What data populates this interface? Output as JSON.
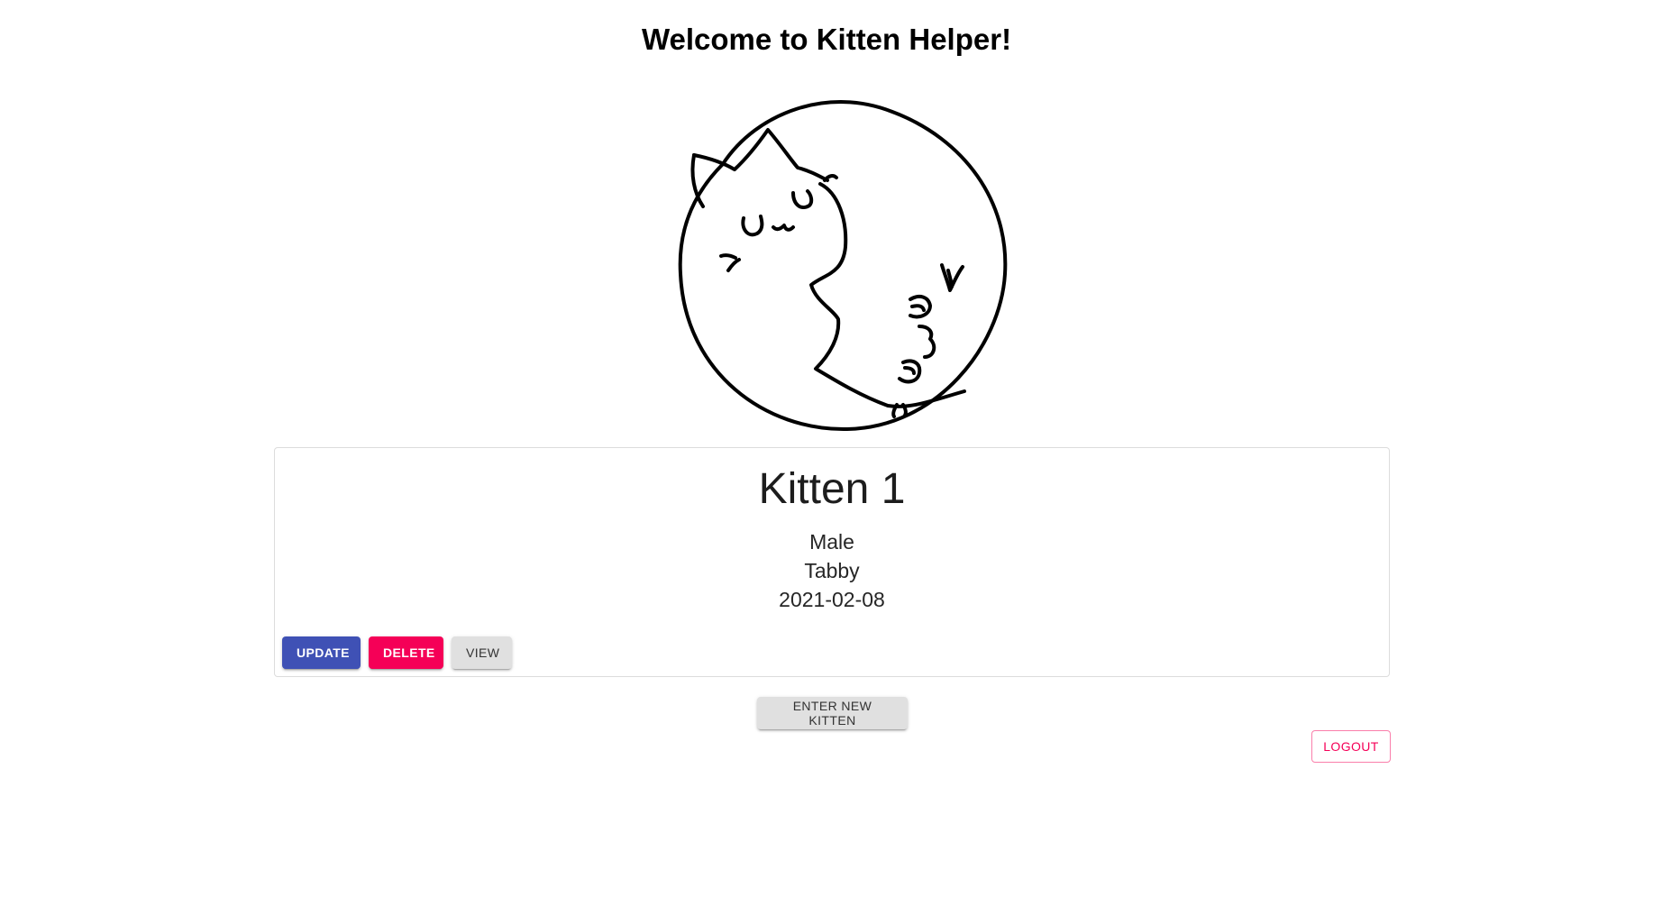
{
  "header": {
    "title": "Welcome to Kitten Helper!"
  },
  "logo": {
    "icon": "kitten-moon-logo"
  },
  "kitten_card": {
    "name": "Kitten 1",
    "sex": "Male",
    "breed": "Tabby",
    "date": "2021-02-08",
    "update_label": "UPDATE",
    "delete_label": "DELETE",
    "view_label": "VIEW"
  },
  "actions": {
    "new_kitten_label": "ENTER NEW KITTEN",
    "logout_label": "LOGOUT"
  },
  "colors": {
    "primary": "#3f51b5",
    "secondary": "#f50057",
    "default_button": "#e0e0e0"
  }
}
